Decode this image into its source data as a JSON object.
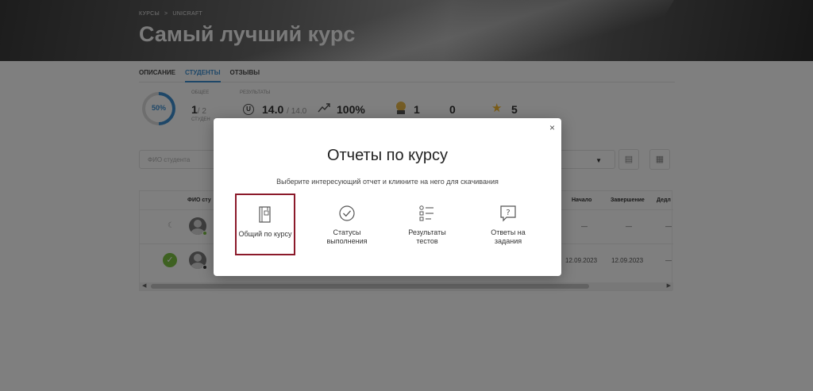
{
  "breadcrumb": {
    "items": [
      "КУРСЫ",
      "UNICRAFT"
    ],
    "separator": ">"
  },
  "course_title": "Самый лучший курс",
  "tabs": [
    {
      "label": "ОПИСАНИЕ",
      "active": false
    },
    {
      "label": "СТУДЕНТЫ",
      "active": true
    },
    {
      "label": "ОТЗЫВЫ",
      "active": false
    }
  ],
  "stats": {
    "progress_percent": "50%",
    "general_caption": "ОБЩЕЕ",
    "students_count": "1",
    "students_total": "/ 2",
    "students_caption": "СТУДЕН",
    "results_caption": "РЕЗУЛЬТАТЫ",
    "u_badge": "U",
    "score": "14.0",
    "score_max": "/ 14.0",
    "percent": "100%",
    "medal_count": "1",
    "zero_count": "0",
    "star_count": "5"
  },
  "filter": {
    "search_placeholder": "ФИО студента"
  },
  "table": {
    "headers": {
      "name": "ФИО сту",
      "start": "Начало",
      "end": "Завершение",
      "deadline": "Дедл"
    },
    "rows": [
      {
        "start": "—",
        "end": "—",
        "deadline": "—",
        "status": "in-progress"
      },
      {
        "start": "12.09.2023",
        "end": "12.09.2023",
        "deadline": "—",
        "status": "completed"
      }
    ]
  },
  "modal": {
    "close": "×",
    "title": "Отчеты по курсу",
    "subtitle": "Выберите интересующий отчет и кликните на него для скачивания",
    "options": [
      {
        "label": "Общий по курсу",
        "icon": "report-book-icon",
        "selected": true
      },
      {
        "label": "Статусы выполнения",
        "icon": "check-circle-icon",
        "selected": false
      },
      {
        "label": "Результаты тестов",
        "icon": "checklist-icon",
        "selected": false
      },
      {
        "label": "Ответы на задания",
        "icon": "question-bubble-icon",
        "selected": false
      }
    ]
  },
  "colors": {
    "accent": "#3c8fd1",
    "selected_border": "#8b1a2a",
    "success": "#7cc242",
    "star": "#f5b82e"
  }
}
